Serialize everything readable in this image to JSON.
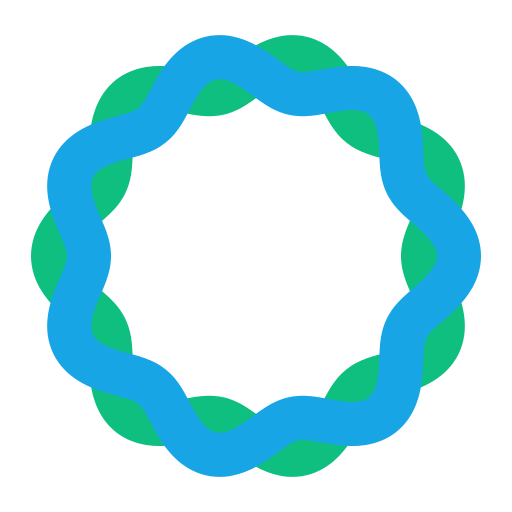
{
  "logo": {
    "icon": "woven-ring-icon",
    "colors": {
      "green": "#0fbf7f",
      "blue": "#17a5e6",
      "background": "#ffffff"
    }
  }
}
